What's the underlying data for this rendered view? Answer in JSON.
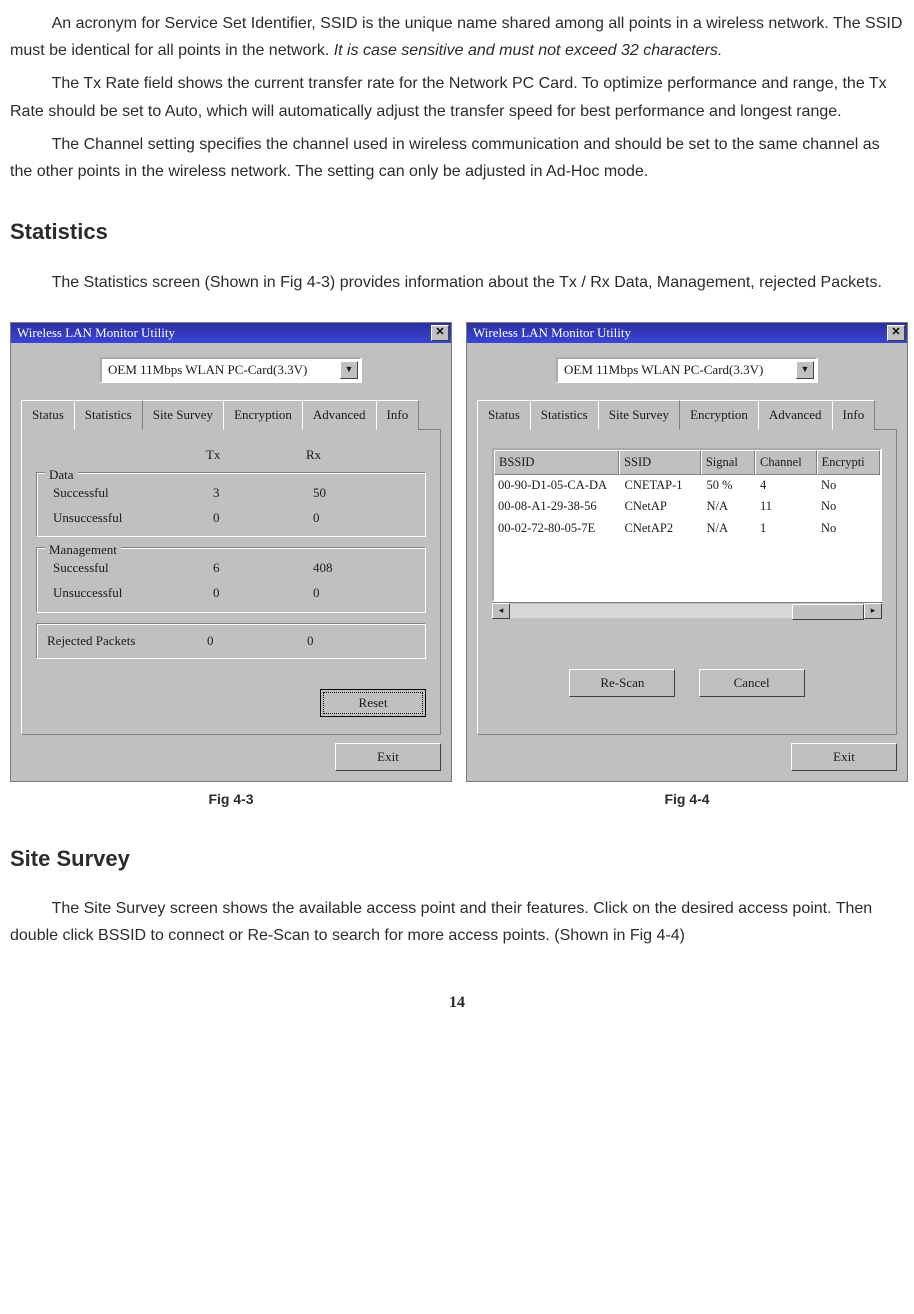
{
  "paragraphs": {
    "p1a": "An acronym for Service Set Identifier, SSID is the unique name shared among all points in a wireless network. The SSID must be identical for all points in the network. ",
    "p1b_italic": "It is case sensitive and must not exceed 32 characters.",
    "p2": "The Tx Rate field shows the current transfer rate for the Network PC Card. To optimize performance and range, the Tx Rate should be set to  Auto, which will automatically adjust the transfer speed for best performance and longest range.",
    "p3": "The Channel setting specifies the channel used in wireless communication and should be set to the same channel as the other points in the wireless network. The setting can only be adjusted in Ad-Hoc mode.",
    "stats_heading": "Statistics",
    "p4": "The Statistics screen (Shown in Fig 4-3) provides information about the Tx / Rx Data, Management, rejected Packets.",
    "survey_heading": "Site Survey",
    "p5": "The Site Survey screen shows the available access point and their features. Click on the desired access point. Then double click BSSID to connect or Re-Scan to search for more access points. (Shown in Fig 4-4)"
  },
  "common": {
    "window_title": "Wireless LAN Monitor Utility",
    "close_glyph": "✕",
    "dropdown_value": "OEM 11Mbps WLAN PC-Card(3.3V)",
    "dd_arrow": "▼",
    "tabs": {
      "status": "Status",
      "statistics": "Statistics",
      "site_survey": "Site Survey",
      "encryption": "Encryption",
      "advanced": "Advanced",
      "info": "Info"
    },
    "exit": "Exit"
  },
  "fig43": {
    "caption": "Fig 4-3",
    "col_tx": "Tx",
    "col_rx": "Rx",
    "group_data": "Data",
    "group_mgmt": "Management",
    "successful": "Successful",
    "unsuccessful": "Unsuccessful",
    "data_s_tx": "3",
    "data_s_rx": "50",
    "data_u_tx": "0",
    "data_u_rx": "0",
    "mgmt_s_tx": "6",
    "mgmt_s_rx": "408",
    "mgmt_u_tx": "0",
    "mgmt_u_rx": "0",
    "rejected_label": "Rejected Packets",
    "rej_tx": "0",
    "rej_rx": "0",
    "reset": "Reset"
  },
  "fig44": {
    "caption": "Fig 4-4",
    "headers": {
      "bssid": "BSSID",
      "ssid": "SSID",
      "signal": "Signal",
      "channel": "Channel",
      "encrypt": "Encrypti"
    },
    "rows": [
      {
        "bssid": "00-90-D1-05-CA-DA",
        "ssid": "CNETAP-1",
        "signal": "50 %",
        "channel": "4",
        "encrypt": "No"
      },
      {
        "bssid": "00-08-A1-29-38-56",
        "ssid": "CNetAP",
        "signal": "N/A",
        "channel": "11",
        "encrypt": "No"
      },
      {
        "bssid": "00-02-72-80-05-7E",
        "ssid": "CNetAP2",
        "signal": "N/A",
        "channel": "1",
        "encrypt": "No"
      }
    ],
    "rescan": "Re-Scan",
    "cancel": "Cancel",
    "arrow_left": "◂",
    "arrow_right": "▸"
  },
  "page_number": "14"
}
